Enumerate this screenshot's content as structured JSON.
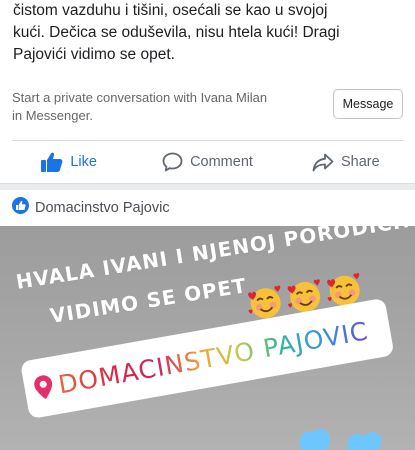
{
  "post": {
    "lines": [
      "čistom vazduhu i tišini,  osećali se kao u svojoj",
      "kući. Dečica se oduševila, nisu htela kući! Dragi",
      "Pajovići vidimo se opet."
    ]
  },
  "messenger": {
    "lines": [
      "Start a private conversation with Ivana Milan",
      "in Messenger."
    ],
    "button_label": "Message"
  },
  "actions": {
    "like_label": "Like",
    "comment_label": "Comment",
    "share_label": "Share"
  },
  "page": {
    "name": "Domacinstvo Pajovic",
    "icon": "like-badge-icon"
  },
  "story": {
    "line1": "HVALA IVANI I NJENOJ PORODICI!",
    "line2": "VIDIMO SE OPET",
    "emoji": [
      "smiling-face-with-hearts",
      "smiling-face-with-hearts",
      "smiling-face-with-hearts"
    ],
    "location": "DOMACINSTVO PAJOVIC"
  },
  "colors": {
    "like_blue": "#1b74e4",
    "muted": "#606770",
    "story_bg": "#a7a7a7"
  }
}
